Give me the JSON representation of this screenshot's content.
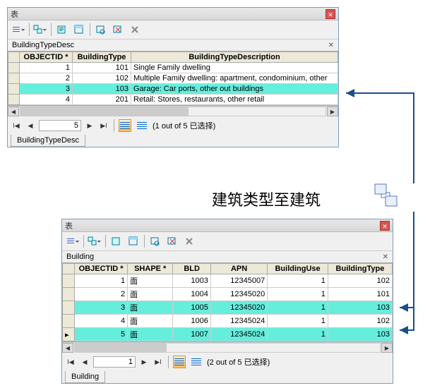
{
  "relation_label": "建筑类型至建筑",
  "panel1": {
    "title": "表",
    "subheader": "BuildingTypeDesc",
    "columns": [
      "OBJECTID *",
      "BuildingType",
      "BuildingTypeDescription"
    ],
    "rows": [
      {
        "sel": false,
        "cells": [
          "1",
          "101",
          "Single Family dwelling"
        ]
      },
      {
        "sel": false,
        "cells": [
          "2",
          "102",
          "Multiple Family dwelling: apartment, condominium, other"
        ]
      },
      {
        "sel": true,
        "cells": [
          "3",
          "103",
          "Garage: Car ports, other out buildings"
        ]
      },
      {
        "sel": false,
        "cells": [
          "4",
          "201",
          "Retail: Stores, restaurants, other retail"
        ]
      }
    ],
    "nav_value": "5",
    "status": "(1 out of 5 已选择)",
    "tab": "BuildingTypeDesc"
  },
  "panel2": {
    "title": "表",
    "subheader": "Building",
    "columns": [
      "OBJECTID *",
      "SHAPE *",
      "BLD",
      "APN",
      "BuildingUse",
      "BuildingType"
    ],
    "rows": [
      {
        "sel": false,
        "cells": [
          "1",
          "面",
          "1003",
          "12345007",
          "1",
          "102"
        ]
      },
      {
        "sel": false,
        "cells": [
          "2",
          "面",
          "1004",
          "12345020",
          "1",
          "101"
        ]
      },
      {
        "sel": true,
        "cells": [
          "3",
          "面",
          "1005",
          "12345020",
          "1",
          "103"
        ]
      },
      {
        "sel": false,
        "cells": [
          "4",
          "面",
          "1006",
          "12345024",
          "1",
          "102"
        ]
      },
      {
        "sel": true,
        "cells": [
          "5",
          "面",
          "1007",
          "12345024",
          "1",
          "103"
        ]
      }
    ],
    "nav_value": "1",
    "status": "(2 out of 5 已选择)",
    "tab": "Building"
  }
}
